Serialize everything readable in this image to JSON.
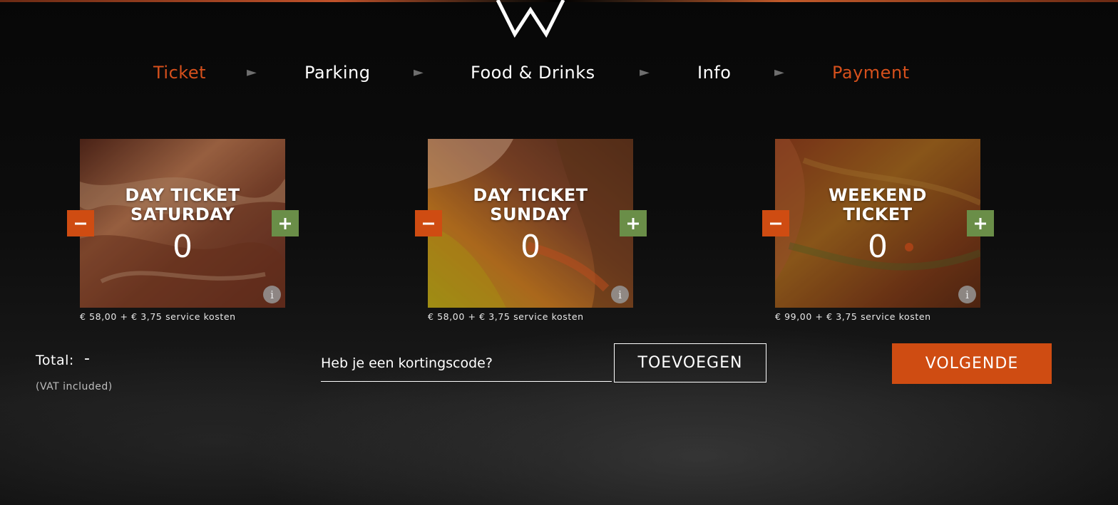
{
  "steps": [
    {
      "label": "Ticket",
      "active": true
    },
    {
      "label": "Parking",
      "active": false
    },
    {
      "label": "Food & Drinks",
      "active": false
    },
    {
      "label": "Info",
      "active": false
    },
    {
      "label": "Payment",
      "active": true
    }
  ],
  "step_separator": "►",
  "tickets": [
    {
      "name_line1": "DAY TICKET",
      "name_line2": "SATURDAY",
      "count": "0",
      "price": "€ 58,00 + € 3,75 service kosten",
      "minus": "−",
      "plus": "+",
      "info": "i"
    },
    {
      "name_line1": "DAY TICKET",
      "name_line2": "SUNDAY",
      "count": "0",
      "price": "€ 58,00 + € 3,75 service kosten",
      "minus": "−",
      "plus": "+",
      "info": "i"
    },
    {
      "name_line1": "WEEKEND",
      "name_line2": "TICKET",
      "count": "0",
      "price": "€ 99,00 + € 3,75 service kosten",
      "minus": "−",
      "plus": "+",
      "info": "i"
    }
  ],
  "total": {
    "label": "Total:",
    "value": "-",
    "vat_note": "(VAT included)"
  },
  "discount": {
    "placeholder": "Heb je een kortingscode?",
    "button_label": "TOEVOEGEN"
  },
  "next_button_label": "VOLGENDE",
  "colors": {
    "accent_orange": "#cf4c12",
    "plus_green": "#6a8e48",
    "active_step": "#d5501c"
  },
  "icons": {
    "logo": "w-logo-icon",
    "minus": "minus-icon",
    "plus": "plus-icon",
    "info": "info-icon",
    "step_arrow": "arrow-right-icon"
  }
}
